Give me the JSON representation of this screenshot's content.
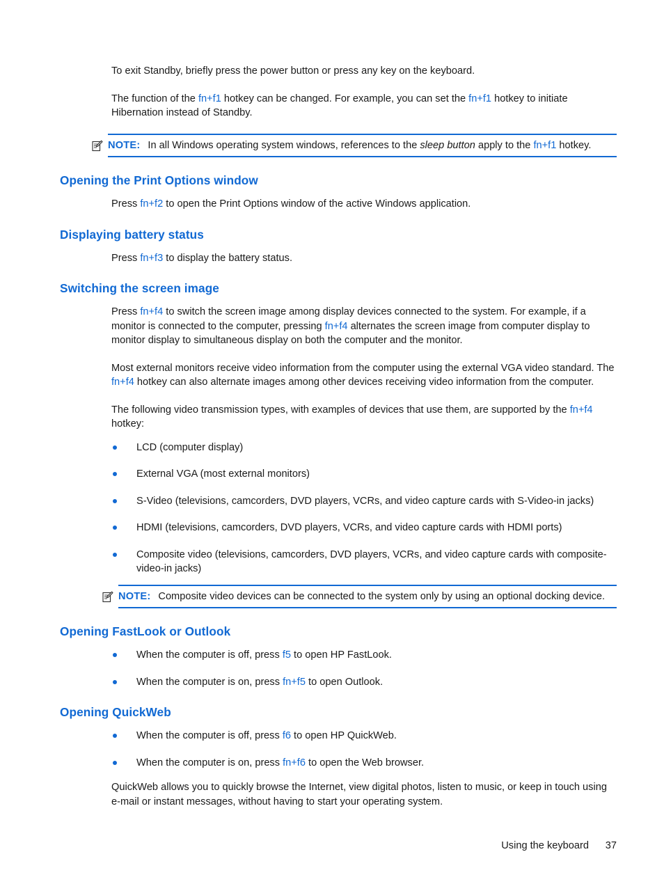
{
  "page": {
    "number": "37",
    "footer_title": "Using the keyboard"
  },
  "intro": {
    "paragraph1": "To exit Standby, briefly press the power button or press any key on the keyboard.",
    "paragraph2_part1": "The function of the ",
    "paragraph2_key1": "fn+f1",
    "paragraph2_part2": " hotkey can be changed. For example, you can set the ",
    "paragraph2_key2": "fn+f1",
    "paragraph2_part3": " hotkey to initiate Hibernation instead of Standby."
  },
  "note1": {
    "icon": "note-pencil-icon",
    "label": "NOTE:",
    "text_part1": "In all Windows operating system windows, references to the ",
    "emphasis": "sleep button",
    "text_part2": " apply to the ",
    "key": "fn+f1",
    "text_part3": " hotkey."
  },
  "sections": {
    "print_options": {
      "heading": "Opening the Print Options window",
      "body_part1": "Press ",
      "key": "fn+f2",
      "body_part2": " to open the Print Options window of the active Windows application."
    },
    "battery_status": {
      "heading": "Displaying battery status",
      "body_part1": "Press ",
      "key": "fn+f3",
      "body_part2": " to display the battery status."
    },
    "screen_image": {
      "heading": "Switching the screen image",
      "p1_part1": "Press ",
      "p1_key1": "fn+f4",
      "p1_part2": " to switch the screen image among display devices connected to the system. For example, if a monitor is connected to the computer, pressing ",
      "p1_key2": "fn+f4",
      "p1_part3": " alternates the screen image from computer display to monitor display to simultaneous display on both the computer and the monitor.",
      "p2_part1": "Most external monitors receive video information from the computer using the external VGA video standard. The ",
      "p2_key": "fn+f4",
      "p2_part2": " hotkey can also alternate images among other devices receiving video information from the computer.",
      "p3_part1": "The following video transmission types, with examples of devices that use them, are supported by the ",
      "p3_key": "fn+f4",
      "p3_part2": " hotkey:",
      "bullets": [
        "LCD (computer display)",
        "External VGA (most external monitors)",
        "S-Video (televisions, camcorders, DVD players, VCRs, and video capture cards with S-Video-in jacks)",
        "HDMI (televisions, camcorders, DVD players, VCRs, and video capture cards with HDMI ports)",
        "Composite video (televisions, camcorders, DVD players, VCRs, and video capture cards with composite-video-in jacks)"
      ]
    },
    "fastlook": {
      "heading": "Opening FastLook or Outlook",
      "bullet1_part1": "When the computer is off, press ",
      "bullet1_key": "f5",
      "bullet1_part2": " to open HP FastLook.",
      "bullet2_part1": "When the computer is on, press ",
      "bullet2_key": "fn+f5",
      "bullet2_part2": " to open Outlook."
    },
    "quickweb": {
      "heading": "Opening QuickWeb",
      "bullet1_part1": "When the computer is off, press ",
      "bullet1_key": "f6",
      "bullet1_part2": " to open HP QuickWeb.",
      "bullet2_part1": "When the computer is on, press ",
      "bullet2_key": "fn+f6",
      "bullet2_part2": " to open the Web browser.",
      "closing": "QuickWeb allows you to quickly browse the Internet, view digital photos, listen to music, or keep in touch using e-mail or instant messages, without having to start your operating system."
    }
  },
  "note2": {
    "icon": "note-pencil-icon",
    "label": "NOTE:",
    "text": "Composite video devices can be connected to the system only by using an optional docking device."
  },
  "colors": {
    "accent_blue": "#1169d3",
    "body_text": "#1a1a1a",
    "page_background": "#ffffff"
  }
}
